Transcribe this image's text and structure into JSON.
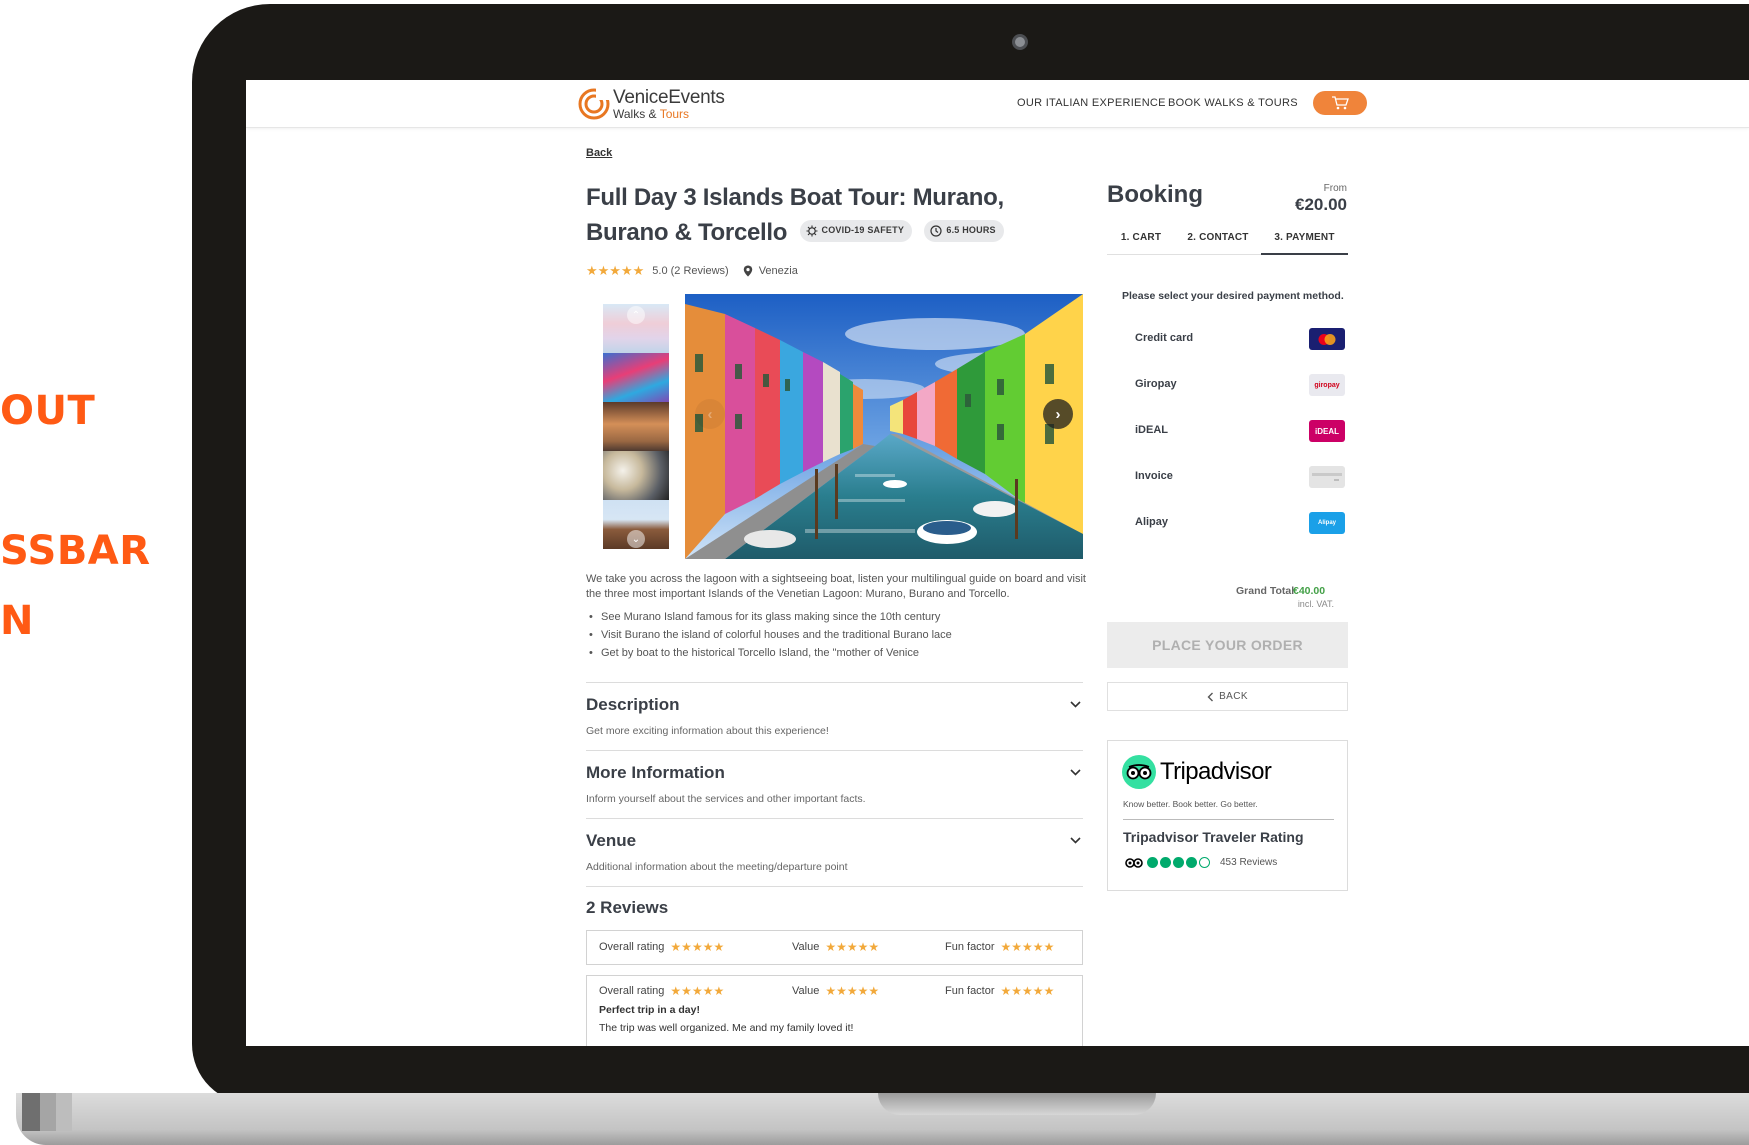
{
  "side_labels": [
    "OUT",
    "SSBAR",
    "N"
  ],
  "nav": {
    "logo_line1": "VeniceEvents",
    "logo_line2_a": "Walks & ",
    "logo_line2_b": "Tours",
    "links": [
      "OUR ITALIAN EXPERIENCE",
      "BOOK WALKS & TOURS"
    ]
  },
  "back_label": "Back",
  "tour": {
    "title": "Full Day 3 Islands Boat Tour: Murano, Burano & Torcello",
    "badges": [
      "COVID-19 SAFETY",
      "6.5 HOURS"
    ],
    "stars": "★★★★★",
    "rating_text": "5.0 (2 Reviews)",
    "location": "Venezia",
    "intro": "We take you across the lagoon with a sightseeing boat, listen your multilingual guide on board and visit the three most important Islands of the Venetian Lagoon: Murano, Burano and Torcello.",
    "highlights": [
      "See Murano Island famous for its glass making since the 10th century",
      "Visit Burano the island of colorful houses and the traditional Burano lace",
      "Get by boat to the historical Torcello Island, the \"mother of Venice"
    ]
  },
  "accordion": [
    {
      "title": "Description",
      "subtitle": "Get more exciting information about this experience!"
    },
    {
      "title": "More Information",
      "subtitle": "Inform yourself about the services and other important facts."
    },
    {
      "title": "Venue",
      "subtitle": "Additional information about the meeting/departure point"
    }
  ],
  "reviews": {
    "title": "2 Reviews",
    "labels": [
      "Overall rating",
      "Value",
      "Fun factor"
    ],
    "stars": "★★★★★",
    "first_title": "Perfect trip in a day!",
    "first_text": "The trip was well organized. Me and my family loved it!"
  },
  "booking": {
    "title": "Booking",
    "from_label": "From",
    "from_price": "€20.00",
    "tabs": [
      "1. CART",
      "2. CONTACT",
      "3. PAYMENT"
    ],
    "active_tab": "3. PAYMENT",
    "prompt": "Please select your desired payment method.",
    "methods": [
      {
        "label": "Credit card",
        "icon": "mastercard-icon",
        "logo_text": ""
      },
      {
        "label": "Giropay",
        "icon": "giropay-icon",
        "logo_text": "giropay"
      },
      {
        "label": "iDEAL",
        "icon": "ideal-icon",
        "logo_text": "iDEAL"
      },
      {
        "label": "Invoice",
        "icon": "invoice-icon",
        "logo_text": ""
      },
      {
        "label": "Alipay",
        "icon": "alipay-icon",
        "logo_text": "Alipay"
      }
    ],
    "grand_total_label": "Grand Total",
    "grand_total_value": "€40.00",
    "vat_note": "incl. VAT.",
    "place_order": "PLACE YOUR ORDER",
    "back": "BACK"
  },
  "tripadvisor": {
    "wordmark": "Tripadvisor",
    "tagline": "Know better. Book better. Go better.",
    "rating_title": "Tripadvisor Traveler Rating",
    "bubbles_filled": 4,
    "bubbles_total": 5,
    "reviews": "453 Reviews"
  },
  "colors": {
    "accent_orange": "#f0843a",
    "side_label_orange": "#ff5a14",
    "star_gold": "#f2a93b",
    "total_green": "#43a047",
    "tripadvisor_green": "#00aa6c"
  }
}
